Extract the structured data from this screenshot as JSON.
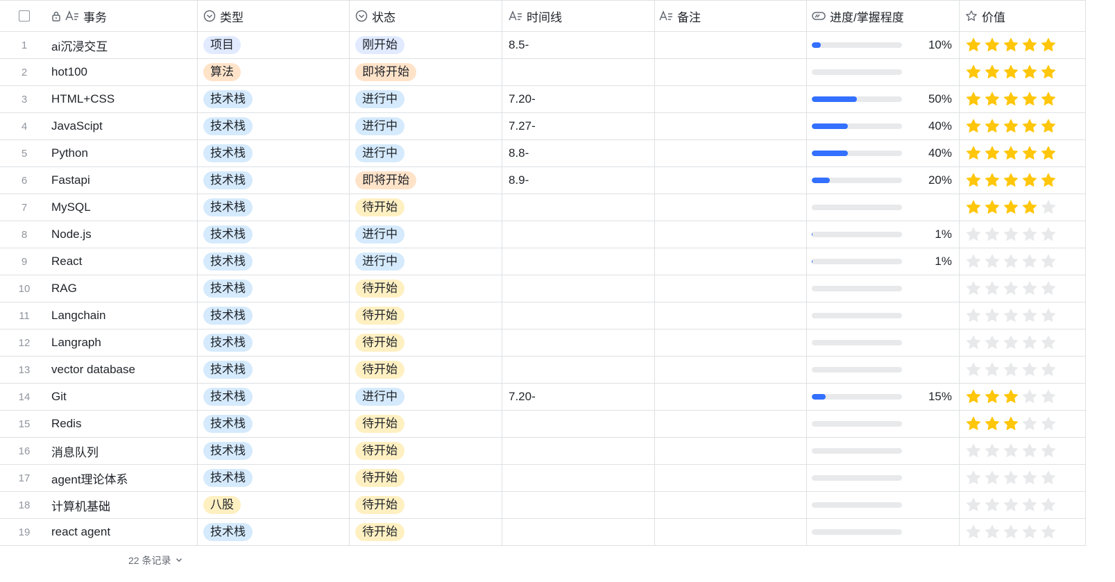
{
  "header": {
    "task": "事务",
    "type": "类型",
    "status": "状态",
    "timeline": "时间线",
    "note": "备注",
    "progress": "进度/掌握程度",
    "value": "价值"
  },
  "colors": {
    "accent": "#3370ff",
    "star_on": "#ffc60a",
    "star_off": "#e8e9eb",
    "tag_jishuzhan": "#d5eafc",
    "tag_xiangmu": "#e1eaff",
    "tag_suanfa": "#ffe3c9",
    "tag_bagu": "#fff0c2"
  },
  "rows": [
    {
      "num": "1",
      "task": "ai沉浸交互",
      "type": "项目",
      "status": "刚开始",
      "time": "8.5-",
      "note": "",
      "progress": 10,
      "progress_label": "10%",
      "stars": 5
    },
    {
      "num": "2",
      "task": "hot100",
      "type": "算法",
      "status": "即将开始",
      "time": "",
      "note": "",
      "progress": 0,
      "progress_label": "",
      "stars": 5
    },
    {
      "num": "3",
      "task": "HTML+CSS",
      "type": "技术栈",
      "status": "进行中",
      "time": "7.20-",
      "note": "",
      "progress": 50,
      "progress_label": "50%",
      "stars": 5
    },
    {
      "num": "4",
      "task": "JavaScipt",
      "type": "技术栈",
      "status": "进行中",
      "time": "7.27-",
      "note": "",
      "progress": 40,
      "progress_label": "40%",
      "stars": 5
    },
    {
      "num": "5",
      "task": "Python",
      "type": "技术栈",
      "status": "进行中",
      "time": "8.8-",
      "note": "",
      "progress": 40,
      "progress_label": "40%",
      "stars": 5
    },
    {
      "num": "6",
      "task": "Fastapi",
      "type": "技术栈",
      "status": "即将开始",
      "time": "8.9-",
      "note": "",
      "progress": 20,
      "progress_label": "20%",
      "stars": 5
    },
    {
      "num": "7",
      "task": "MySQL",
      "type": "技术栈",
      "status": "待开始",
      "time": "",
      "note": "",
      "progress": 0,
      "progress_label": "",
      "stars": 4
    },
    {
      "num": "8",
      "task": "Node.js",
      "type": "技术栈",
      "status": "进行中",
      "time": "",
      "note": "",
      "progress": 1,
      "progress_label": "1%",
      "stars": 0
    },
    {
      "num": "9",
      "task": "React",
      "type": "技术栈",
      "status": "进行中",
      "time": "",
      "note": "",
      "progress": 1,
      "progress_label": "1%",
      "stars": 0
    },
    {
      "num": "10",
      "task": "RAG",
      "type": "技术栈",
      "status": "待开始",
      "time": "",
      "note": "",
      "progress": 0,
      "progress_label": "",
      "stars": 0
    },
    {
      "num": "11",
      "task": "Langchain",
      "type": "技术栈",
      "status": "待开始",
      "time": "",
      "note": "",
      "progress": 0,
      "progress_label": "",
      "stars": 0
    },
    {
      "num": "12",
      "task": "Langraph",
      "type": "技术栈",
      "status": "待开始",
      "time": "",
      "note": "",
      "progress": 0,
      "progress_label": "",
      "stars": 0
    },
    {
      "num": "13",
      "task": "vector database",
      "type": "技术栈",
      "status": "待开始",
      "time": "",
      "note": "",
      "progress": 0,
      "progress_label": "",
      "stars": 0
    },
    {
      "num": "14",
      "task": "Git",
      "type": "技术栈",
      "status": "进行中",
      "time": "7.20-",
      "note": "",
      "progress": 15,
      "progress_label": "15%",
      "stars": 3
    },
    {
      "num": "15",
      "task": "Redis",
      "type": "技术栈",
      "status": "待开始",
      "time": "",
      "note": "",
      "progress": 0,
      "progress_label": "",
      "stars": 3
    },
    {
      "num": "16",
      "task": "消息队列",
      "type": "技术栈",
      "status": "待开始",
      "time": "",
      "note": "",
      "progress": 0,
      "progress_label": "",
      "stars": 0
    },
    {
      "num": "17",
      "task": "agent理论体系",
      "type": "技术栈",
      "status": "待开始",
      "time": "",
      "note": "",
      "progress": 0,
      "progress_label": "",
      "stars": 0
    },
    {
      "num": "18",
      "task": "计算机基础",
      "type": "八股",
      "status": "待开始",
      "time": "",
      "note": "",
      "progress": 0,
      "progress_label": "",
      "stars": 0
    },
    {
      "num": "19",
      "task": "react agent",
      "type": "技术栈",
      "status": "待开始",
      "time": "",
      "note": "",
      "progress": 0,
      "progress_label": "",
      "stars": 0
    }
  ],
  "footer": {
    "count_label": "22 条记录"
  }
}
